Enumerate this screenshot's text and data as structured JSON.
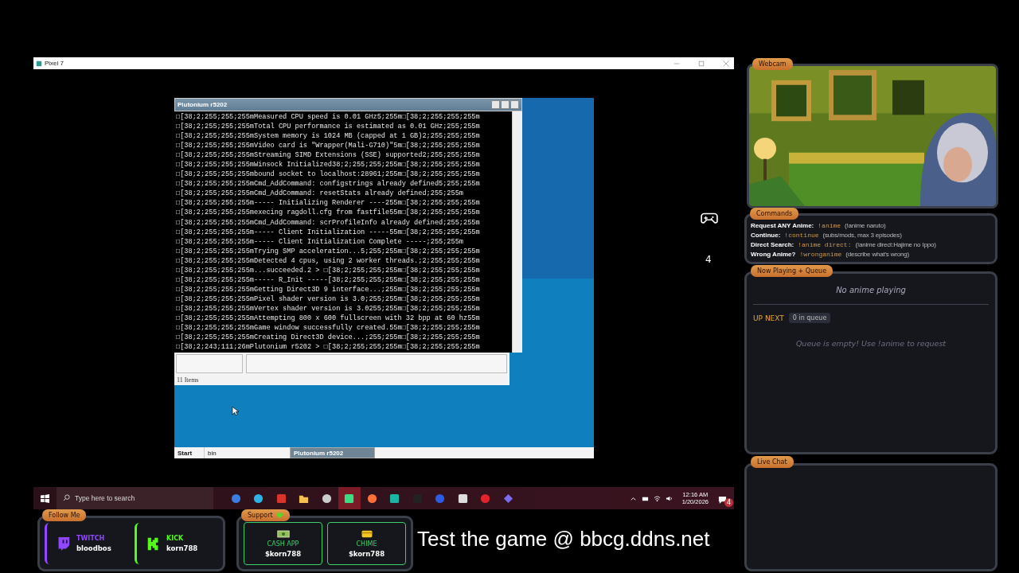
{
  "main_window": {
    "title": "Pixel 7"
  },
  "console": {
    "title": "Plutonium r5202",
    "lines": [
      "□[38;2;255;255;255mMeasured CPU speed is 0.01 GHz5;255m□[38;2;255;255;255m",
      "□[38;2;255;255;255mTotal CPU performance is estimated as 0.01 GHz;255;255m",
      "□[38;2;255;255;255mSystem memory is 1024 MB (capped at 1 GB)2;255;255;255m",
      "□[38;2;255;255;255mVideo card is \"Wrapper(Mali-G710)\"5m□[38;2;255;255;255m",
      "□[38;2;255;255;255mStreaming SIMD Extensions (SSE) supported2;255;255;255m",
      "□[38;2;255;255;255mWinsock Initialized38;2;255;255;255m□[38;2;255;255;255m",
      "□[38;2;255;255;255mbound socket to localhost:28961;255m□[38;2;255;255;255m",
      "□[38;2;255;255;255mCmd_AddCommand: configstrings already defined5;255;255m",
      "□[38;2;255;255;255mCmd_AddCommand: resetStats already defined;255;255m",
      "□[38;2;255;255;255m----- Initializing Renderer ----255m□[38;2;255;255;255m",
      "□[38;2;255;255;255mexecing ragdoll.cfg from fastfile55m□[38;2;255;255;255m",
      "□[38;2;255;255;255mCmd_AddCommand: scrProfileInfo already defined;255;255m",
      "□[38;2;255;255;255m----- Client Initialization -----55m□[38;2;255;255;255m",
      "□[38;2;255;255;255m----- Client Initialization Complete -----;255;255m",
      "□[38;2;255;255;255mTrying SMP acceleration...5;255;255m□[38;2;255;255;255m",
      "□[38;2;255;255;255mDetected 4 cpus, using 2 worker threads.;2;255;255;255m",
      "□[38;2;255;255;255m...succeeded.2 > □[38;2;255;255;255m□[38;2;255;255;255m",
      "□[38;2;255;255;255m----- R_Init -----[38;2;255;255;255m□[38;2;255;255;255m",
      "□[38;2;255;255;255mGetting Direct3D 9 interface...;255m□[38;2;255;255;255m",
      "□[38;2;255;255;255mPixel shader version is 3.0;255;255m□[38;2;255;255;255m",
      "□[38;2;255;255;255mVertex shader version is 3.0255;255m□[38;2;255;255;255m",
      "□[38;2;255;255;255mAttempting 800 x 600 fullscreen with 32 bpp at 60 hz55m",
      "□[38;2;255;255;255mGame window successfully created.55m□[38;2;255;255;255m",
      "□[38;2;255;255;255mCreating Direct3D device...;255;255m□[38;2;255;255;255m",
      "□[38;2;243;111;26mPlutonium r5202 > □[38;2;255;255;255m□[38;2;255;255;255m"
    ]
  },
  "explorer": {
    "status": "11 Items"
  },
  "emulator_taskbar": {
    "start": "Start",
    "items": [
      {
        "label": "bin",
        "selected": false
      },
      {
        "label": "Plutonium r5202",
        "selected": true
      }
    ]
  },
  "side_counter": "4",
  "taskbar": {
    "search_placeholder": "Type here to search",
    "apps": [
      {
        "selected": false
      },
      {
        "selected": false
      },
      {
        "selected": false
      },
      {
        "selected": false
      },
      {
        "selected": false
      },
      {
        "selected": true
      },
      {
        "selected": false
      },
      {
        "selected": false
      },
      {
        "selected": false
      },
      {
        "selected": false
      },
      {
        "selected": false
      },
      {
        "selected": false
      },
      {
        "selected": false
      }
    ],
    "time": "12:16 AM",
    "date": "1/20/2026",
    "notifications": "4"
  },
  "webcam": {
    "label": "Webcam"
  },
  "commands": {
    "label": "Commands",
    "rows": [
      {
        "name": "Request ANY Anime:",
        "command": "!anime",
        "example": "(!anime naruto)"
      },
      {
        "name": "Continue:",
        "command": "!continue",
        "example": "(subs/mods, max 3 episodes)"
      },
      {
        "name": "Direct Search:",
        "command": "!anime direct:",
        "example": "(!anime direct:Hajime no Ippo)"
      },
      {
        "name": "Wrong Anime?",
        "command": "!wronganime",
        "example": "(describe what's wrong)"
      }
    ]
  },
  "now_playing": {
    "label": "Now Playing + Queue",
    "status": "No anime playing",
    "up_next": "UP NEXT",
    "queue_count": "0 in queue",
    "queue_empty": "Queue is empty! Use !anime to request"
  },
  "live_chat": {
    "label": "Live Chat"
  },
  "follow": {
    "label": "Follow Me",
    "items": [
      {
        "kind": "twitch",
        "platform": "TWITCH",
        "handle": "bloodbos",
        "color": "#9146ff"
      },
      {
        "kind": "kick",
        "platform": "KICK",
        "handle": "korn788",
        "color": "#53fc18"
      }
    ]
  },
  "support": {
    "label": "Support",
    "items": [
      {
        "kind": "cash",
        "platform": "CASH APP",
        "handle": "$korn788"
      },
      {
        "kind": "card",
        "platform": "CHIME",
        "handle": "$korn788"
      }
    ]
  },
  "banner": "Test the game @ bbcg.ddns.net"
}
